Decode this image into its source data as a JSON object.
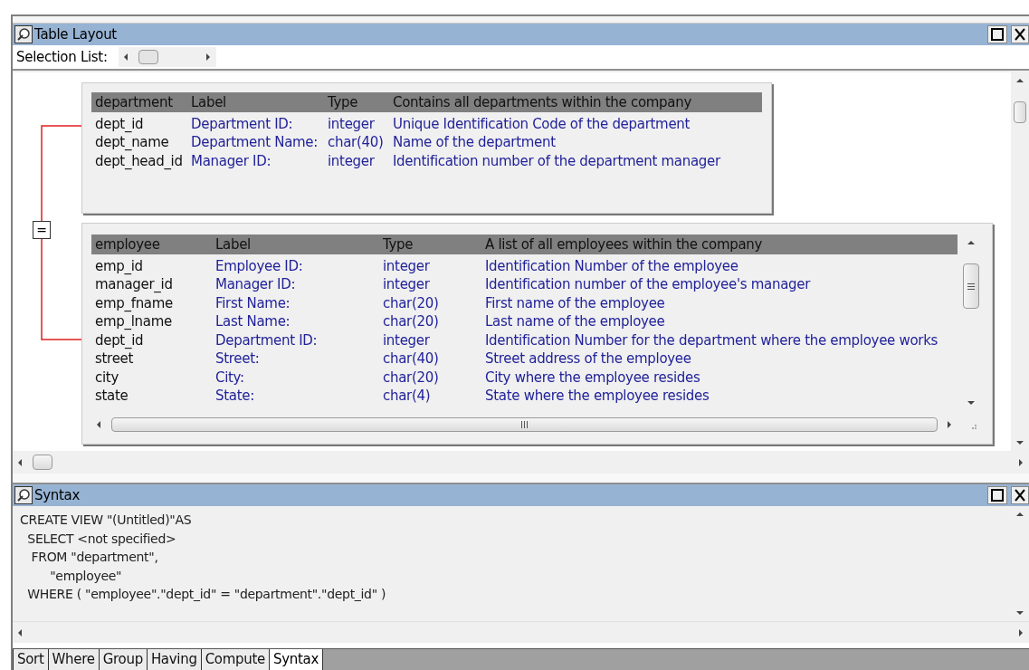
{
  "layout_panel": {
    "title": "Table Layout",
    "selection_list_label": "Selection List:",
    "tables": [
      {
        "name": "department",
        "header": {
          "label": "Label",
          "type": "Type",
          "description": "Contains all departments within the company"
        },
        "rows": [
          {
            "name": "dept_id",
            "label": "Department ID:",
            "type": "integer",
            "description": "Unique Identification Code of the department"
          },
          {
            "name": "dept_name",
            "label": "Department Name:",
            "type": "char(40)",
            "description": "Name of the department"
          },
          {
            "name": "dept_head_id",
            "label": "Manager ID:",
            "type": "integer",
            "description": "Identification number of the department manager"
          }
        ]
      },
      {
        "name": "employee",
        "header": {
          "label": "Label",
          "type": "Type",
          "description": "A list of all employees within the company"
        },
        "rows": [
          {
            "name": "emp_id",
            "label": "Employee ID:",
            "type": "integer",
            "description": "Identification Number of the employee"
          },
          {
            "name": "manager_id",
            "label": "Manager ID:",
            "type": "integer",
            "description": "Identification number of the employee's manager"
          },
          {
            "name": "emp_fname",
            "label": "First Name:",
            "type": "char(20)",
            "description": "First name of the employee"
          },
          {
            "name": "emp_lname",
            "label": "Last Name:",
            "type": "char(20)",
            "description": "Last name of the employee"
          },
          {
            "name": "dept_id",
            "label": "Department ID:",
            "type": "integer",
            "description": "Identification Number for the department where the employee works"
          },
          {
            "name": "street",
            "label": "Street:",
            "type": "char(40)",
            "description": "Street address of the employee"
          },
          {
            "name": "city",
            "label": "City:",
            "type": "char(20)",
            "description": "City where the employee resides"
          },
          {
            "name": "state",
            "label": "State:",
            "type": "char(4)",
            "description": "State where the employee resides"
          }
        ]
      }
    ],
    "join": {
      "operator": "="
    }
  },
  "syntax_panel": {
    "title": "Syntax",
    "lines": [
      "CREATE VIEW \"(Untitled)\"AS",
      "  SELECT <not specified>",
      "   FROM \"department\",",
      "        \"employee\"",
      "  WHERE ( \"employee\".\"dept_id\" = \"department\".\"dept_id\" )"
    ]
  },
  "tabs": [
    {
      "label": "Sort",
      "selected": false
    },
    {
      "label": "Where",
      "selected": false
    },
    {
      "label": "Group",
      "selected": false
    },
    {
      "label": "Having",
      "selected": false
    },
    {
      "label": "Compute",
      "selected": false
    },
    {
      "label": "Syntax",
      "selected": true
    }
  ]
}
